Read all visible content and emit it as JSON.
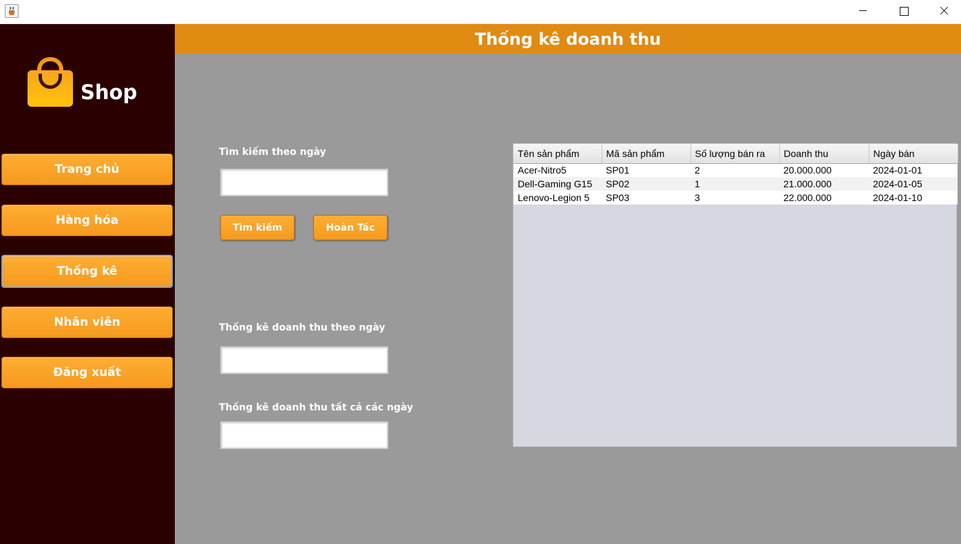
{
  "window": {
    "icon": "java-cup-icon",
    "controls": [
      "minimize-icon",
      "maximize-icon",
      "close-icon"
    ]
  },
  "sidebar": {
    "logo_text": "Shop",
    "logo_icon": "shopping-bag-icon",
    "items": [
      {
        "label": "Trang chủ"
      },
      {
        "label": "Hàng hóa"
      },
      {
        "label": "Thống kê",
        "active": true
      },
      {
        "label": "Nhân viên"
      },
      {
        "label": "Đăng xuất"
      }
    ]
  },
  "header": {
    "title": "Thống kê doanh thu"
  },
  "search": {
    "label": "Tìm kiếm theo ngày",
    "value": "",
    "search_button": "Tìm kiếm",
    "undo_button": "Hoàn Tác"
  },
  "stats": {
    "by_day_label": "Thống kê doanh thu theo ngày",
    "by_day_value": "",
    "all_days_label": "Thống kê doanh thu tất cả các ngày",
    "all_days_value": ""
  },
  "table": {
    "columns": [
      "Tên sản phẩm",
      "Mã sản phẩm",
      "Số lượng bán ra",
      "Doanh thu",
      "Ngày bán"
    ],
    "rows": [
      [
        "Acer-Nitro5",
        "SP01",
        "2",
        "20.000.000",
        "2024-01-01"
      ],
      [
        "Dell-Gaming G15",
        "SP02",
        "1",
        "21.000.000",
        "2024-01-05"
      ],
      [
        "Lenovo-Legion 5",
        "SP03",
        "3",
        "22.000.000",
        "2024-01-10"
      ]
    ]
  },
  "colors": {
    "sidebar_bg": "#2b0000",
    "accent_orange": "#e08b12",
    "button_orange": "#f59a1e",
    "content_bg": "#9a9a9a"
  }
}
